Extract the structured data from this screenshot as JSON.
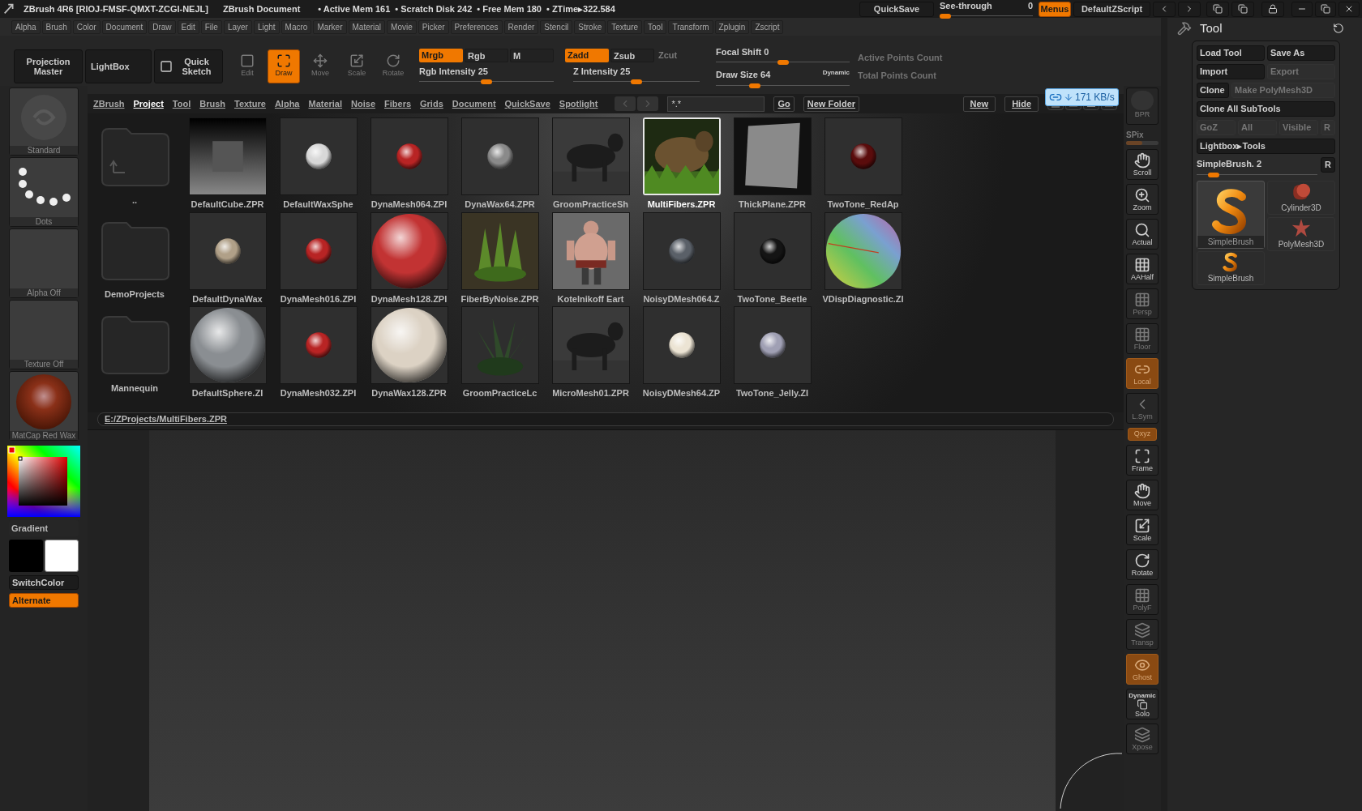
{
  "title_bar": {
    "app": "ZBrush 4R6 [RIOJ-FMSF-QMXT-ZCGI-NEJL]",
    "document": "ZBrush Document",
    "stats": [
      "• Active Mem 161",
      "• Scratch Disk 242",
      "• Free Mem 180",
      "• ZTime▸322.584"
    ]
  },
  "top_right": {
    "quicksave": "QuickSave",
    "see_through": {
      "label": "See-through",
      "reading": "0",
      "level": 0
    },
    "menus": {
      "label": "Menus",
      "on": true
    },
    "script": "DefaultZScript"
  },
  "menu_bar": [
    "Alpha",
    "Brush",
    "Color",
    "Document",
    "Draw",
    "Edit",
    "File",
    "Layer",
    "Light",
    "Macro",
    "Marker",
    "Material",
    "Movie",
    "Picker",
    "Preferences",
    "Render",
    "Stencil",
    "Stroke",
    "Texture",
    "Tool",
    "Transform",
    "Zplugin",
    "Zscript"
  ],
  "toolbar": {
    "big_buttons": [
      "Projection Master",
      "LightBox",
      "Quick Sketch"
    ],
    "modes": [
      {
        "label": "Edit",
        "selected": false,
        "disabled": true
      },
      {
        "label": "Draw",
        "selected": true,
        "disabled": false
      },
      {
        "label": "Move",
        "selected": false,
        "disabled": true
      },
      {
        "label": "Scale",
        "selected": false,
        "disabled": true
      },
      {
        "label": "Rotate",
        "selected": false,
        "disabled": true
      }
    ],
    "rgb_toggles": [
      {
        "label": "Mrgb",
        "on": true,
        "disabled": false
      },
      {
        "label": "Rgb",
        "on": false,
        "disabled": false
      },
      {
        "label": "M",
        "on": false,
        "disabled": false
      }
    ],
    "z_toggles": [
      {
        "label": "Zadd",
        "on": true,
        "disabled": false
      },
      {
        "label": "Zsub",
        "on": false,
        "disabled": false
      },
      {
        "label": "Zcut",
        "on": false,
        "disabled": true
      }
    ],
    "rgb_intensity": {
      "label": "Rgb Intensity 25",
      "level": 0.5
    },
    "z_intensity": {
      "label": "Z Intensity 25",
      "level": 0.5
    },
    "focal_shift": {
      "label": "Focal Shift 0",
      "level": 0.5
    },
    "draw_size": {
      "label": "Draw Size 64",
      "level": 0.27
    },
    "dynamic": "Dynamic",
    "counts": [
      "Active Points Count",
      "Total Points Count"
    ]
  },
  "left_panel": {
    "brush": "Standard",
    "stroke": "Dots",
    "alpha": "Alpha Off",
    "texture": "Texture Off",
    "material": "MatCap Red Wax",
    "gradient": "Gradient",
    "switch_color": "SwitchColor",
    "alternate": {
      "label": "Alternate",
      "on": true
    }
  },
  "lightbox": {
    "tabs": [
      {
        "label": "ZBrush",
        "selected": false
      },
      {
        "label": "Project",
        "selected": true
      },
      {
        "label": "Tool",
        "selected": false
      },
      {
        "label": "Brush",
        "selected": false
      },
      {
        "label": "Texture",
        "selected": false
      },
      {
        "label": "Alpha",
        "selected": false
      },
      {
        "label": "Material",
        "selected": false
      },
      {
        "label": "Noise",
        "selected": false
      },
      {
        "label": "Fibers",
        "selected": false
      },
      {
        "label": "Grids",
        "selected": false
      },
      {
        "label": "Document",
        "selected": false
      },
      {
        "label": "QuickSave",
        "selected": false
      },
      {
        "label": "Spotlight",
        "selected": false
      }
    ],
    "filter": "*.*",
    "go": "Go",
    "new_folder": "New Folder",
    "new": "New",
    "hide": "Hide",
    "folders": [
      "..",
      "DemoProjects",
      "Mannequin"
    ],
    "files": [
      {
        "name": "DefaultCube.ZPR",
        "kind": "cube",
        "selected": false
      },
      {
        "name": "DefaultWaxSphe",
        "kind": "sphere",
        "color": "#d8d8d8",
        "selected": false
      },
      {
        "name": "DynaMesh064.ZPI",
        "kind": "sphere",
        "color": "#b82424",
        "selected": false
      },
      {
        "name": "DynaWax64.ZPR",
        "kind": "sphere",
        "color": "#8a8a8a",
        "selected": false
      },
      {
        "name": "GroomPracticeSh",
        "kind": "picture",
        "selected": false
      },
      {
        "name": "MultiFibers.ZPR",
        "kind": "picture",
        "selected": true
      },
      {
        "name": "ThickPlane.ZPR",
        "kind": "plane",
        "selected": false
      },
      {
        "name": "TwoTone_RedAp",
        "kind": "sphere",
        "color": "#5a0c0c",
        "selected": false
      },
      {
        "name": "DefaultDynaWax",
        "kind": "sphere",
        "color": "#b0a088",
        "selected": false
      },
      {
        "name": "DynaMesh016.ZPI",
        "kind": "sphere",
        "color": "#b82424",
        "selected": false
      },
      {
        "name": "DynaMesh128.ZPI",
        "kind": "large-sphere",
        "color": "#c23333",
        "selected": false
      },
      {
        "name": "FiberByNoise.ZPR",
        "kind": "picture",
        "selected": false
      },
      {
        "name": "Kotelnikoff Eart",
        "kind": "picture",
        "selected": false
      },
      {
        "name": "NoisyDMesh064.Z",
        "kind": "sphere",
        "color": "#5a6068",
        "selected": false
      },
      {
        "name": "TwoTone_Beetle",
        "kind": "sphere",
        "color": "#141414",
        "selected": false
      },
      {
        "name": "VDispDiagnostic.ZI",
        "kind": "diagnostic-sphere",
        "selected": false
      },
      {
        "name": "DefaultSphere.ZI",
        "kind": "large-sphere",
        "color": "#8a8e92",
        "selected": false
      },
      {
        "name": "DynaMesh032.ZPI",
        "kind": "sphere",
        "color": "#b82424",
        "selected": false
      },
      {
        "name": "DynaWax128.ZPR",
        "kind": "large-sphere",
        "color": "#dcd2c4",
        "selected": false
      },
      {
        "name": "GroomPracticeLc",
        "kind": "picture",
        "selected": false
      },
      {
        "name": "MicroMesh01.ZPR",
        "kind": "picture",
        "selected": false
      },
      {
        "name": "NoisyDMesh64.ZP",
        "kind": "sphere",
        "color": "#ece4d4",
        "selected": false
      },
      {
        "name": "TwoTone_Jelly.ZI",
        "kind": "sphere",
        "color": "#a0a0b4",
        "selected": false
      }
    ],
    "path": "E:/ZProjects/MultiFibers.ZPR"
  },
  "net_meter": "171 KB/s",
  "right_toolbar": [
    {
      "label": "BPR",
      "kind": "button",
      "disabled": true,
      "highlighted": false
    },
    {
      "label": "SPix",
      "kind": "slider",
      "level": 0.5,
      "disabled": true
    },
    {
      "label": "Scroll",
      "kind": "button",
      "disabled": false,
      "highlighted": false
    },
    {
      "label": "Zoom",
      "kind": "button",
      "disabled": false,
      "highlighted": false
    },
    {
      "label": "Actual",
      "kind": "button",
      "disabled": false,
      "highlighted": false
    },
    {
      "label": "AAHalf",
      "kind": "button",
      "disabled": false,
      "highlighted": false
    },
    {
      "label": "Persp",
      "kind": "button",
      "disabled": true,
      "highlighted": false
    },
    {
      "label": "Floor",
      "kind": "button",
      "disabled": true,
      "highlighted": false
    },
    {
      "label": "Local",
      "kind": "button",
      "disabled": true,
      "highlighted": true
    },
    {
      "label": "L.Sym",
      "kind": "button",
      "disabled": true,
      "highlighted": false
    },
    {
      "label": "Qxyz",
      "kind": "small",
      "disabled": true,
      "highlighted": true
    },
    {
      "label": "Frame",
      "kind": "button",
      "disabled": false,
      "highlighted": false
    },
    {
      "label": "Move",
      "kind": "button",
      "disabled": false,
      "highlighted": false
    },
    {
      "label": "Scale",
      "kind": "button",
      "disabled": false,
      "highlighted": false
    },
    {
      "label": "Rotate",
      "kind": "button",
      "disabled": false,
      "highlighted": false
    },
    {
      "label": "PolyF",
      "kind": "button",
      "disabled": true,
      "highlighted": false
    },
    {
      "label": "Transp",
      "kind": "button",
      "disabled": true,
      "highlighted": false
    },
    {
      "label": "Ghost",
      "kind": "button",
      "disabled": true,
      "highlighted": true
    },
    {
      "label": "Solo",
      "caption": "Dynamic",
      "kind": "button",
      "disabled": false,
      "highlighted": false
    },
    {
      "label": "Xpose",
      "kind": "button",
      "disabled": true,
      "highlighted": false
    }
  ],
  "tool_panel": {
    "title": "Tool",
    "buttons": [
      [
        {
          "label": "Load Tool",
          "disabled": false
        },
        {
          "label": "Save As",
          "disabled": false
        }
      ],
      [
        {
          "label": "Import",
          "disabled": false
        },
        {
          "label": "Export",
          "disabled": true
        }
      ],
      [
        {
          "label": "Clone",
          "disabled": false
        },
        {
          "label": "Make PolyMesh3D",
          "disabled": true
        }
      ],
      [
        {
          "label": "Clone All SubTools",
          "disabled": false
        }
      ],
      [
        {
          "label": "GoZ",
          "disabled": true
        },
        {
          "label": "All",
          "disabled": true
        },
        {
          "label": "Visible",
          "disabled": true
        },
        {
          "label": "R",
          "disabled": true
        }
      ],
      [
        {
          "label": "Lightbox▸Tools",
          "disabled": false
        }
      ]
    ],
    "current": {
      "label": "SimpleBrush. 2",
      "level": 0.1,
      "reset": "R"
    },
    "tools": [
      {
        "name": "SimpleBrush",
        "kind": "brush",
        "selected": true
      },
      {
        "name": "SimpleBrush",
        "kind": "small-brush",
        "selected": false
      },
      {
        "name": "Cylinder3D",
        "kind": "cylinder",
        "selected": false
      },
      {
        "name": "PolyMesh3D",
        "kind": "star",
        "selected": false
      }
    ]
  }
}
